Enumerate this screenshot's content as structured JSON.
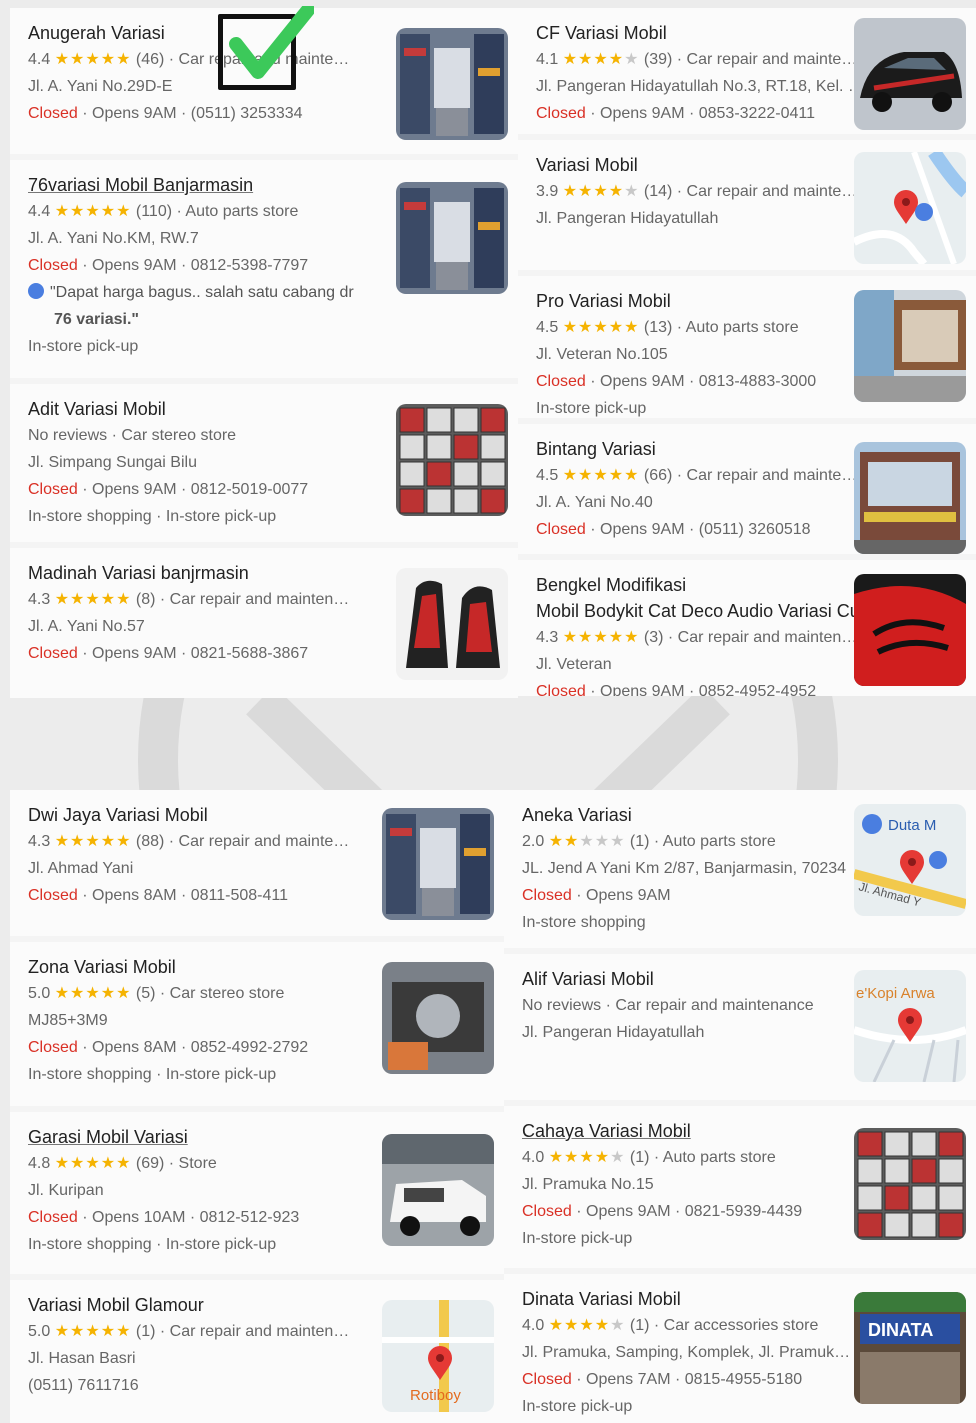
{
  "panels": [
    {
      "id": "top-left",
      "cards": [
        {
          "name": "Anugerah Variasi",
          "underline": false,
          "rating": "4.4",
          "stars": 4.4,
          "reviews": "(46)",
          "category": "Car repair and mainte…",
          "address": "Jl. A. Yani No.29D-E",
          "status": "Closed",
          "hours": "Opens 9AM · (0511) 3253334",
          "extra": "",
          "quote": "",
          "quote_bold": "",
          "thumb": "shop-interior"
        },
        {
          "name": "76variasi Mobil Banjarmasin",
          "underline": true,
          "rating": "4.4",
          "stars": 4.4,
          "reviews": "(110)",
          "category": "Auto parts store",
          "address": "Jl. A. Yani No.KM, RW.7",
          "status": "Closed",
          "hours": "Opens 9AM · 0812-5398-7797",
          "quote": "\"Dapat harga bagus.. salah satu cabang dr",
          "quote_bold": "76 variasi.\"",
          "extra": "In-store pick-up",
          "thumb": "shop-interior"
        },
        {
          "name": "Adit Variasi Mobil",
          "underline": false,
          "rating": "",
          "stars": 0,
          "reviews": "No reviews",
          "category": "Car stereo store",
          "address": "Jl. Simpang Sungai Bilu",
          "status": "Closed",
          "hours": "Opens 9AM · 0812-5019-0077",
          "extra": "In-store shopping · In-store pick-up",
          "quote": "",
          "quote_bold": "",
          "thumb": "shelves"
        },
        {
          "name": "Madinah Variasi banjrmasin",
          "underline": false,
          "rating": "4.3",
          "stars": 4.3,
          "reviews": "(8)",
          "category": "Car repair and mainten…",
          "address": "Jl. A. Yani No.57",
          "status": "Closed",
          "hours": "Opens 9AM · 0821-5688-3867",
          "extra": "",
          "quote": "",
          "quote_bold": "",
          "thumb": "seats"
        }
      ]
    },
    {
      "id": "top-right",
      "cards": [
        {
          "name": "CF Variasi Mobil",
          "underline": false,
          "rating": "4.1",
          "stars": 4.1,
          "reviews": "(39)",
          "category": "Car repair and mainte…",
          "address": "Jl. Pangeran Hidayatullah No.3, RT.18, Kel. …",
          "status": "Closed",
          "hours": "Opens 9AM · 0853-3222-0411",
          "extra": "",
          "quote": "",
          "quote_bold": "",
          "thumb": "car-dark"
        },
        {
          "name": "Variasi Mobil",
          "underline": false,
          "rating": "3.9",
          "stars": 3.9,
          "reviews": "(14)",
          "category": "Car repair and mainte…",
          "address": "Jl. Pangeran Hidayatullah",
          "status": "",
          "hours": "",
          "extra": "",
          "quote": "",
          "quote_bold": "",
          "thumb": "map"
        },
        {
          "name": "Pro Variasi Mobil",
          "underline": false,
          "rating": "4.5",
          "stars": 4.5,
          "reviews": "(13)",
          "category": "Auto parts store",
          "address": "Jl. Veteran No.105",
          "status": "Closed",
          "hours": "Opens 9AM · 0813-4883-3000",
          "extra": "In-store pick-up",
          "quote": "",
          "quote_bold": "",
          "thumb": "storefront"
        },
        {
          "name": "Bintang Variasi",
          "underline": false,
          "rating": "4.5",
          "stars": 4.5,
          "reviews": "(66)",
          "category": "Car repair and mainte…",
          "address": "Jl. A. Yani No.40",
          "status": "Closed",
          "hours": "Opens 9AM · (0511) 3260518",
          "extra": "",
          "quote": "",
          "quote_bold": "",
          "thumb": "building"
        },
        {
          "name": "Bengkel Modifikasi",
          "name2": "Mobil Bodykit Cat Deco Audio Variasi Cu:",
          "underline": false,
          "rating": "4.3",
          "stars": 4.3,
          "reviews": "(3)",
          "category": "Car repair and mainten…",
          "address": "Jl. Veteran",
          "status": "Closed",
          "hours": "Opens 9AM · 0852-4952-4952",
          "extra": "",
          "quote": "",
          "quote_bold": "",
          "thumb": "red-car"
        }
      ]
    },
    {
      "id": "bottom-left",
      "cards": [
        {
          "name": "Dwi Jaya Variasi Mobil",
          "underline": false,
          "rating": "4.3",
          "stars": 4.3,
          "reviews": "(88)",
          "category": "Car repair and mainte…",
          "address": "Jl. Ahmad Yani",
          "status": "Closed",
          "hours": "Opens 8AM · 0811-508-411",
          "extra": "",
          "quote": "",
          "quote_bold": "",
          "thumb": "shop-interior"
        },
        {
          "name": "Zona Variasi Mobil",
          "underline": false,
          "rating": "5.0",
          "stars": 5.0,
          "reviews": "(5)",
          "category": "Car stereo store",
          "address": "MJ85+3M9",
          "status": "Closed",
          "hours": "Opens 8AM · 0852-4992-2792",
          "extra": "In-store shopping · In-store pick-up",
          "quote": "",
          "quote_bold": "",
          "thumb": "workshop"
        },
        {
          "name": "Garasi Mobil Variasi",
          "underline": true,
          "rating": "4.8",
          "stars": 4.8,
          "reviews": "(69)",
          "category": "Store",
          "address": "Jl. Kuripan",
          "status": "Closed",
          "hours": "Opens 10AM · 0812-512-923",
          "extra": "In-store shopping · In-store pick-up",
          "quote": "",
          "quote_bold": "",
          "thumb": "white-truck"
        },
        {
          "name": "Variasi Mobil Glamour",
          "underline": false,
          "rating": "5.0",
          "stars": 5.0,
          "reviews": "(1)",
          "category": "Car repair and mainten…",
          "address": "Jl. Hasan Basri",
          "status": "",
          "hours": "(0511) 7611716",
          "extra": "",
          "quote": "",
          "quote_bold": "",
          "thumb": "map-rotiboy"
        }
      ]
    },
    {
      "id": "bottom-right",
      "cards": [
        {
          "name": "Aneka Variasi",
          "underline": false,
          "rating": "2.0",
          "stars": 2.0,
          "reviews": "(1)",
          "category": "Auto parts store",
          "address": "JL. Jend A Yani Km 2/87, Banjarmasin, 70234",
          "status": "Closed",
          "hours": "Opens 9AM",
          "extra": "In-store shopping",
          "quote": "",
          "quote_bold": "",
          "thumb": "map-duta"
        },
        {
          "name": "Alif Variasi Mobil",
          "underline": false,
          "rating": "",
          "stars": 0,
          "reviews": "No reviews",
          "category": "Car repair and maintenance",
          "address": "Jl. Pangeran Hidayatullah",
          "status": "",
          "hours": "",
          "extra": "",
          "quote": "",
          "quote_bold": "",
          "thumb": "map-kopi"
        },
        {
          "name": "Cahaya Variasi Mobil",
          "underline": true,
          "rating": "4.0",
          "stars": 4.0,
          "reviews": "(1)",
          "category": "Auto parts store",
          "address": "Jl. Pramuka No.15",
          "status": "Closed",
          "hours": "Opens 9AM · 0821-5939-4439",
          "extra": "In-store pick-up",
          "quote": "",
          "quote_bold": "",
          "thumb": "shelves"
        },
        {
          "name": "Dinata Variasi Mobil",
          "underline": false,
          "rating": "4.0",
          "stars": 4.0,
          "reviews": "(1)",
          "category": "Car accessories store",
          "address": "Jl. Pramuka, Samping, Komplek, Jl. Pramuk…",
          "status": "Closed",
          "hours": "Opens 7AM · 0815-4955-5180",
          "extra": "In-store pick-up",
          "quote": "",
          "quote_bold": "",
          "thumb": "dinata"
        }
      ]
    }
  ],
  "map_labels": {
    "rotiboy": "Rotiboy",
    "duta": "Duta M",
    "ahmad": "Jl. Ahmad Y",
    "kopi": "e'Kopi Arwa",
    "dinata_sign": "DINATA"
  },
  "colors": {
    "star": "#f5b301",
    "closed": "#d93025",
    "pin": "#e53935",
    "map": "#e8eef0"
  }
}
